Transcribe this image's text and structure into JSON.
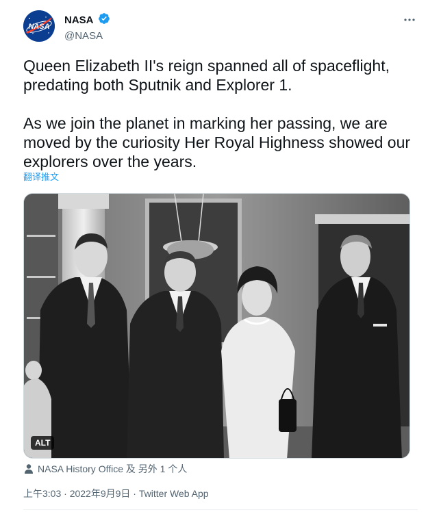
{
  "author": {
    "display_name": "NASA",
    "handle": "@NASA",
    "avatar_text": "NASA",
    "avatar_icon": "nasa-meatball-logo",
    "verified_icon": "verified-badge-icon",
    "more_icon": "more-options-icon"
  },
  "tweet": {
    "text": "Queen Elizabeth II's reign spanned all of spaceflight, predating both Sputnik and Explorer 1.\n\nAs we join the planet in marking her passing, we are moved by the curiosity Her Royal Highness showed our explorers over the years.",
    "translate_label": "翻译推文"
  },
  "media": {
    "alt_badge": "ALT"
  },
  "tagged": {
    "icon": "person-icon",
    "text": "NASA History Office 及 另外 1 个人"
  },
  "meta": {
    "time": "上午3:03",
    "sep1": " · ",
    "date": "2022年9月9日",
    "sep2": " · ",
    "source": "Twitter Web App"
  },
  "colors": {
    "link": "#1d9bf0",
    "secondary_text": "#536471",
    "primary_text": "#0f1419",
    "verified": "#1d9bf0",
    "nasa_blue": "#0b3d91",
    "nasa_red": "#fc3d21"
  }
}
